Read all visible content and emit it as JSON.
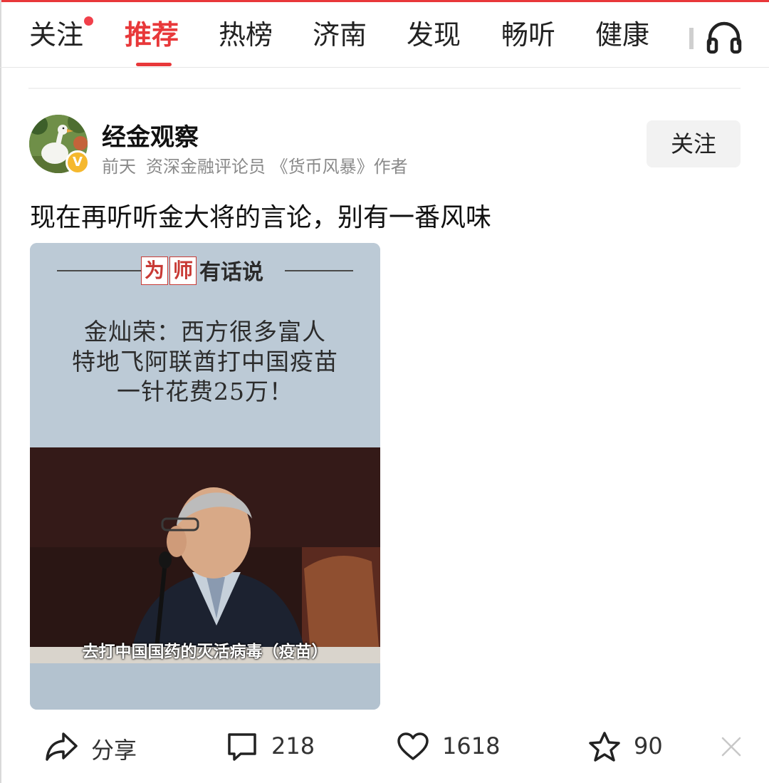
{
  "tabs": [
    {
      "label": "关注",
      "has_dot": true
    },
    {
      "label": "推荐",
      "active": true
    },
    {
      "label": "热榜"
    },
    {
      "label": "济南"
    },
    {
      "label": "发现"
    },
    {
      "label": "畅听"
    },
    {
      "label": "健康"
    }
  ],
  "colors": {
    "accent": "#e8383a",
    "dot": "#f1404b",
    "badge": "#f5b82e"
  },
  "author": {
    "name": "经金观察",
    "time": "前天",
    "description": "资深金融评论员 《货币风暴》作者",
    "follow_label": "关注",
    "badge_letter": "V"
  },
  "post": {
    "text": "现在再听听金大将的言论，别有一番风味"
  },
  "media": {
    "tag_chars": [
      "为",
      "师"
    ],
    "tag_rest": "有话说",
    "quote_lines": [
      "金灿荣：西方很多富人",
      "特地飞阿联酋打中国疫苗",
      "一针花费25万！"
    ],
    "subtitle": "去打中国国药的灭活病毒（疫苗）"
  },
  "actions": {
    "share_label": "分享",
    "comments": "218",
    "likes": "1618",
    "favorites": "90"
  },
  "icons": [
    "red-dot",
    "headphones-icon",
    "verified-icon",
    "share-icon",
    "comment-icon",
    "heart-icon",
    "star-icon",
    "close-icon"
  ]
}
